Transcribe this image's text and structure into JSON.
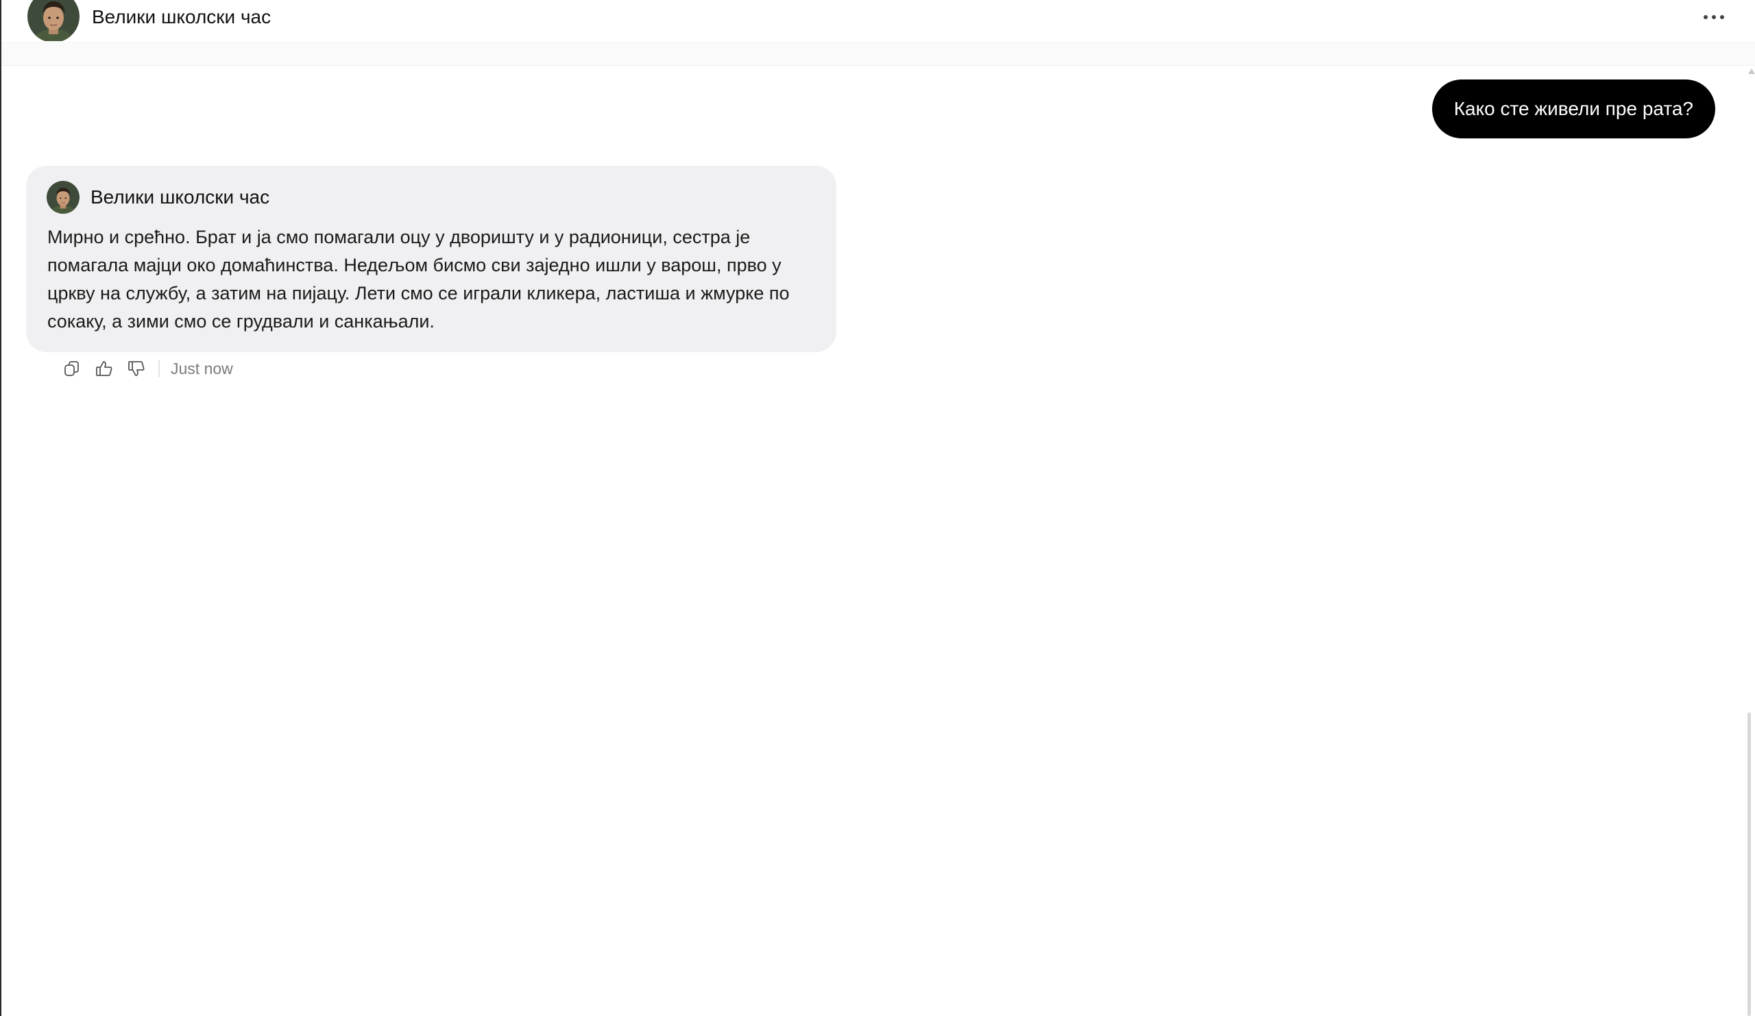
{
  "header": {
    "title": "Велики школски час",
    "menu_icon": "more-horizontal-icon"
  },
  "conversation": {
    "user_message": "Како сте живели пре рата?",
    "bot_message": {
      "name": "Велики школски час",
      "text": "Мирно и срећно. Брат и ја смо помагали оцу у дворишту и у радионици, сестра је помагала мајци око домаћинства. Недељом бисмо сви заједно ишли у варош, прво у цркву на службу, а затим на пијацу. Лети смо се играли кликера, ластиша и жмурке по сокаку, а зими смо се грудвали и санкањали.",
      "timestamp": "Just now",
      "actions": [
        "copy-icon",
        "thumbs-up-icon",
        "thumbs-down-icon"
      ]
    }
  },
  "colors": {
    "user_bubble": "#000000",
    "bot_card": "#f0f0f2",
    "timestamp": "#7a7a7a"
  }
}
